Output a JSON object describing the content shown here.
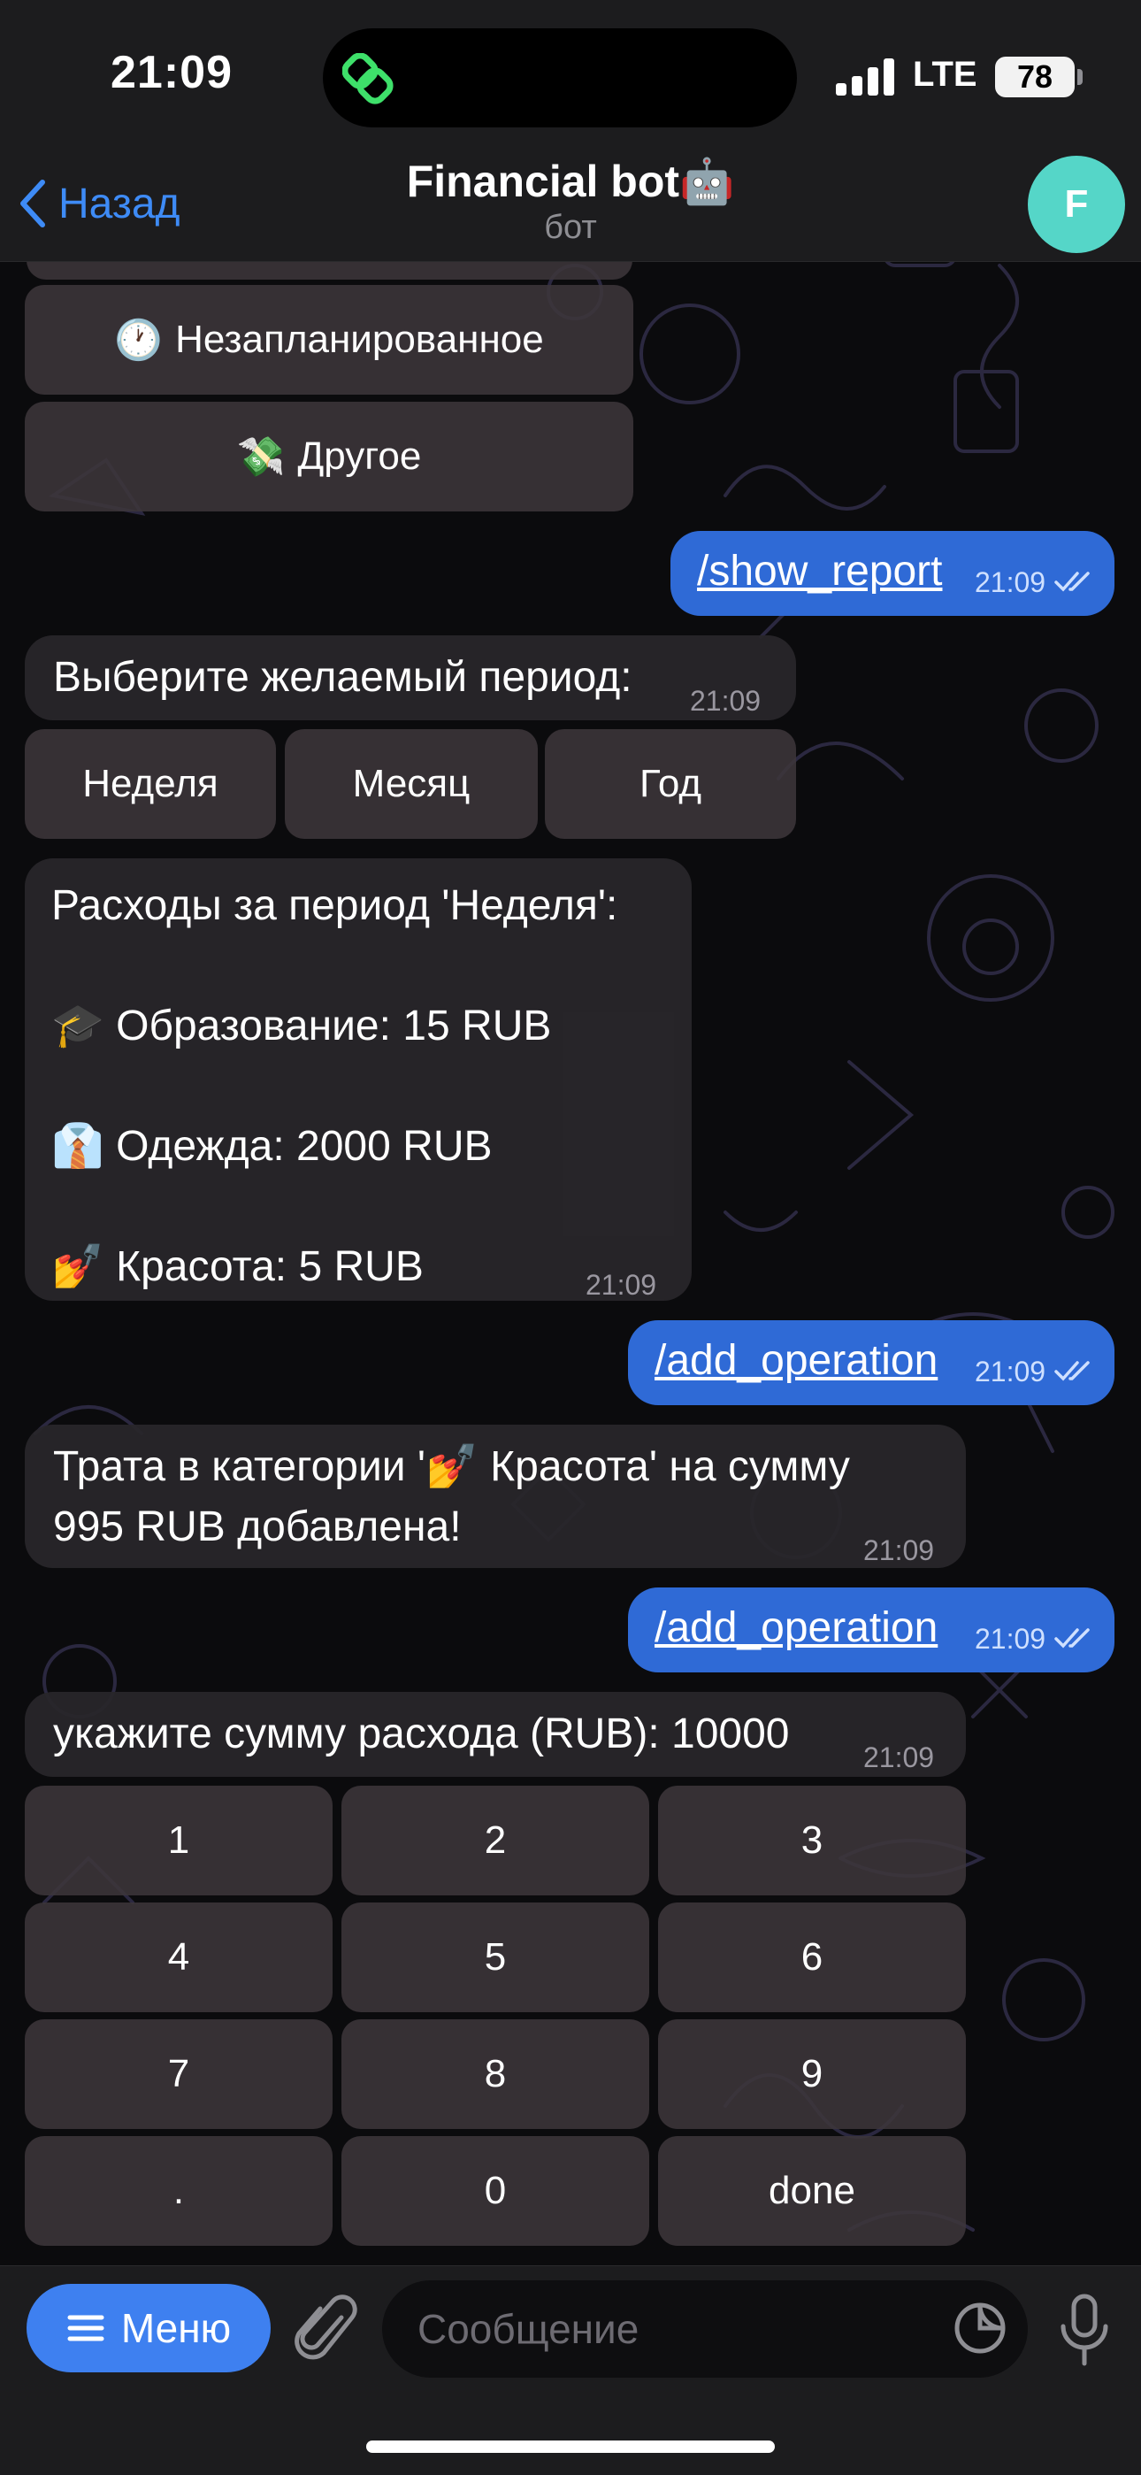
{
  "status_bar": {
    "time": "21:09",
    "network": "LTE",
    "battery": "78"
  },
  "header": {
    "back_label": "Назад",
    "title": "Financial bot🤖",
    "subtitle": "бот",
    "avatar_letter": "F"
  },
  "category_buttons": [
    {
      "emoji": "🕐",
      "label": "Незапланированное"
    },
    {
      "emoji": "💸",
      "label": "Другое"
    }
  ],
  "messages": {
    "show_report": {
      "text": "/show_report",
      "time": "21:09"
    },
    "choose_period": {
      "text": "Выберите желаемый период:",
      "time": "21:09"
    },
    "period_buttons": [
      "Неделя",
      "Месяц",
      "Год"
    ],
    "report": {
      "title": "Расходы за период 'Неделя':",
      "lines": [
        {
          "emoji": "🎓",
          "text": "Образование: 15 RUB"
        },
        {
          "emoji": "👔",
          "text": "Одежда: 2000 RUB"
        },
        {
          "emoji": "💅",
          "text": "Красота: 5 RUB"
        }
      ],
      "time": "21:09"
    },
    "add_operation_1": {
      "text": "/add_operation",
      "time": "21:09"
    },
    "added": {
      "line1_pre": "Трата в категории '",
      "emoji": "💅",
      "line1_post": " Красота' на сумму",
      "line2": "995 RUB добавлена!",
      "time": "21:09"
    },
    "add_operation_2": {
      "text": "/add_operation",
      "time": "21:09"
    },
    "enter_amount": {
      "text": "укажите сумму расхода (RUB): 10000",
      "time": "21:09"
    }
  },
  "numpad": [
    "1",
    "2",
    "3",
    "4",
    "5",
    "6",
    "7",
    "8",
    "9",
    ".",
    "0",
    "done"
  ],
  "composer": {
    "menu_label": "Меню",
    "placeholder": "Сообщение"
  }
}
